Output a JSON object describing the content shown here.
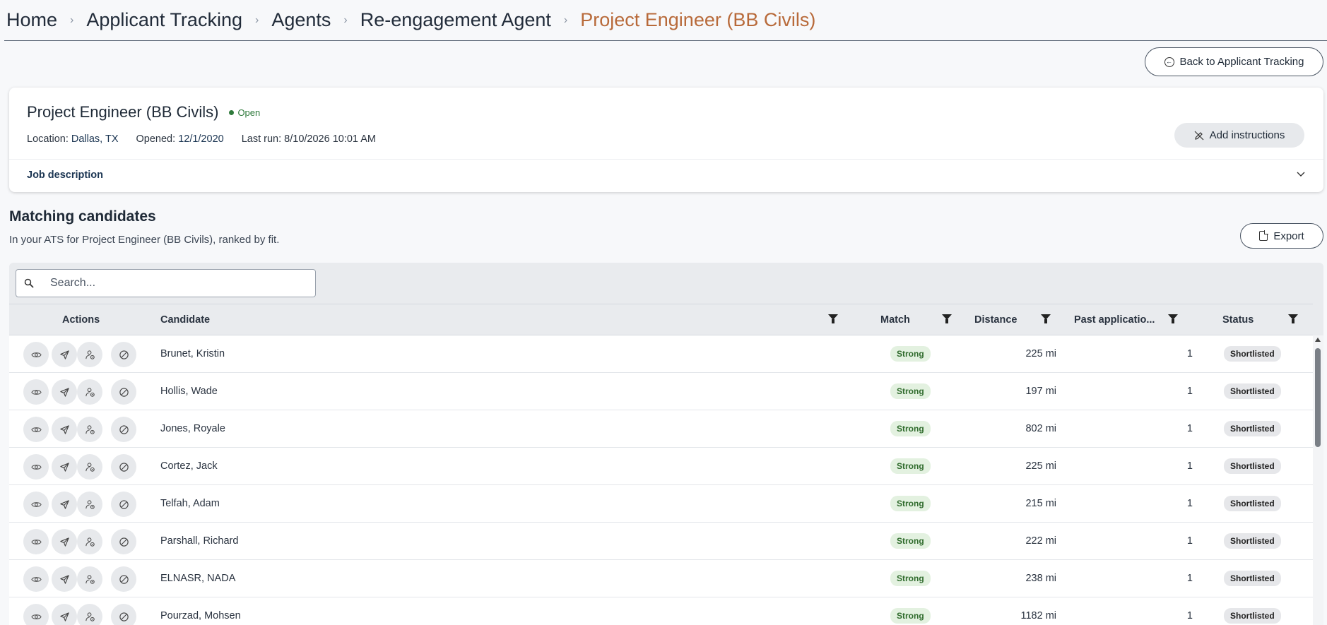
{
  "breadcrumb": {
    "items": [
      "Home",
      "Applicant Tracking",
      "Agents",
      "Re-engagement Agent"
    ],
    "current": "Project Engineer (BB Civils)"
  },
  "back_button": {
    "label": "Back to Applicant Tracking",
    "icon": "arrow-left-circle-icon"
  },
  "job": {
    "title": "Project Engineer (BB Civils)",
    "status": "Open",
    "status_color": "#2f7a3c",
    "location_label": "Location:",
    "location": "Dallas, TX",
    "opened_label": "Opened:",
    "opened": "12/1/2020",
    "last_run_label": "Last run:",
    "last_run": "8/10/2026 10:01 AM",
    "add_instructions_label": "Add instructions",
    "job_description_label": "Job description"
  },
  "matching": {
    "title": "Matching candidates",
    "subtitle": "In your ATS for Project Engineer (BB Civils), ranked by fit.",
    "export_label": "Export"
  },
  "search": {
    "placeholder": "Search..."
  },
  "table": {
    "columns": {
      "actions": "Actions",
      "candidate": "Candidate",
      "match": "Match",
      "distance": "Distance",
      "past_applications": "Past applicatio...",
      "status": "Status"
    },
    "rows": [
      {
        "candidate": "Brunet, Kristin",
        "match": "Strong",
        "distance": "225 mi",
        "past_applications": "1",
        "status": "Shortlisted"
      },
      {
        "candidate": "Hollis, Wade",
        "match": "Strong",
        "distance": "197 mi",
        "past_applications": "1",
        "status": "Shortlisted"
      },
      {
        "candidate": "Jones, Royale",
        "match": "Strong",
        "distance": "802 mi",
        "past_applications": "1",
        "status": "Shortlisted"
      },
      {
        "candidate": "Cortez, Jack",
        "match": "Strong",
        "distance": "225 mi",
        "past_applications": "1",
        "status": "Shortlisted"
      },
      {
        "candidate": "Telfah, Adam",
        "match": "Strong",
        "distance": "215 mi",
        "past_applications": "1",
        "status": "Shortlisted"
      },
      {
        "candidate": "Parshall, Richard",
        "match": "Strong",
        "distance": "222 mi",
        "past_applications": "1",
        "status": "Shortlisted"
      },
      {
        "candidate": "ELNASR, NADA",
        "match": "Strong",
        "distance": "238 mi",
        "past_applications": "1",
        "status": "Shortlisted"
      },
      {
        "candidate": "Pourzad, Mohsen",
        "match": "Strong",
        "distance": "1182 mi",
        "past_applications": "1",
        "status": "Shortlisted"
      }
    ]
  },
  "colors": {
    "accent": "#b86a3a",
    "strong_bg": "#e3f1e0",
    "strong_text": "#2f6b2c"
  }
}
